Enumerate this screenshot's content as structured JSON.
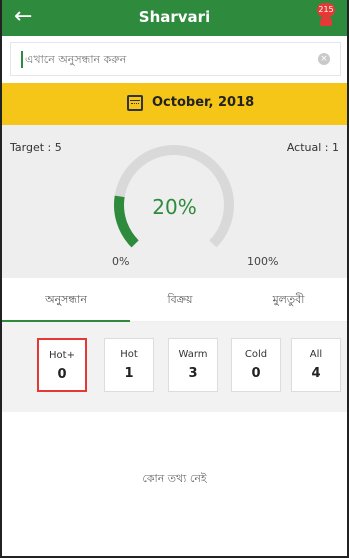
{
  "header": {
    "back_icon": "arrow-left-icon",
    "title": "Sharvari",
    "badge": "215",
    "notif_icon": "bell-icon"
  },
  "search": {
    "placeholder": "এখানে অনুসন্ধান করুন",
    "value": "",
    "clear_icon": "clear-icon"
  },
  "month": {
    "icon": "calendar-icon",
    "label": "October, 2018"
  },
  "gauge": {
    "target_label": "Target : 5",
    "actual_label": "Actual : 1",
    "percent_text": "20%",
    "percent": 0.2,
    "min_label": "0%",
    "max_label": "100%",
    "colors": {
      "fill": "#2e8b3e",
      "track": "#d9d9d9"
    }
  },
  "tabs": [
    {
      "label": "অনুসন্ধান",
      "active": true
    },
    {
      "label": "বিক্রয়",
      "active": false
    },
    {
      "label": "মুলতুবী",
      "active": false
    }
  ],
  "filters": [
    {
      "label": "Hot+",
      "value": "0",
      "selected": true
    },
    {
      "label": "Hot",
      "value": "1",
      "selected": false
    },
    {
      "label": "Warm",
      "value": "3",
      "selected": false
    },
    {
      "label": "Cold",
      "value": "0",
      "selected": false
    },
    {
      "label": "All",
      "value": "4",
      "selected": false
    }
  ],
  "empty_message": "কোন তথ্য নেই",
  "colors": {
    "primary": "#2e8b3e",
    "accent": "#f5c518",
    "selected_border": "#e53935"
  }
}
